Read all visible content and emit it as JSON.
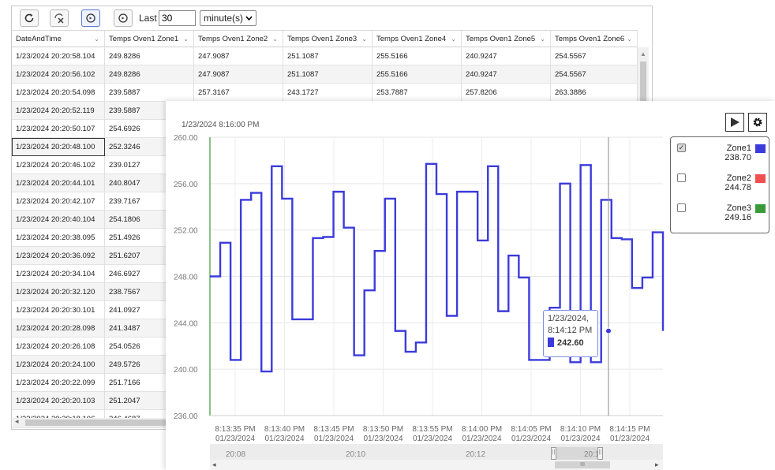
{
  "toolbar": {
    "refresh_icon": "refresh-icon",
    "clear_icon": "clear-filter-icon",
    "live_icon": "live-icon",
    "history_icon": "history-icon",
    "last_label": "Last",
    "last_value": "30",
    "unit_value": "minute(s)"
  },
  "table": {
    "columns": [
      "DateAndTime",
      "Temps Oven1 Zone1",
      "Temps Oven1 Zone2",
      "Temps Oven1 Zone3",
      "Temps Oven1 Zone4",
      "Temps Oven1 Zone5",
      "Temps Oven1 Zone6"
    ],
    "rows": [
      [
        "1/23/2024 20:20:58.104",
        "249.8286",
        "247.9087",
        "251.1087",
        "255.5166",
        "240.9247",
        "254.5567"
      ],
      [
        "1/23/2024 20:20:56.102",
        "249.8286",
        "247.9087",
        "251.1087",
        "255.5166",
        "240.9247",
        "254.5567"
      ],
      [
        "1/23/2024 20:20:54.098",
        "239.5887",
        "257.3167",
        "243.1727",
        "253.7887",
        "257.8206",
        "263.3886"
      ],
      [
        "1/23/2024 20:20:52.119",
        "239.5887",
        "",
        "",
        "",
        "",
        ""
      ],
      [
        "1/23/2024 20:20:50.107",
        "254.6926",
        "",
        "",
        "",
        "",
        ""
      ],
      [
        "1/23/2024 20:20:48.100",
        "252.3246",
        "",
        "",
        "",
        "",
        ""
      ],
      [
        "1/23/2024 20:20:46.102",
        "239.0127",
        "",
        "",
        "",
        "",
        ""
      ],
      [
        "1/23/2024 20:20:44.101",
        "240.8047",
        "",
        "",
        "",
        "",
        ""
      ],
      [
        "1/23/2024 20:20:42.107",
        "239.7167",
        "",
        "",
        "",
        "",
        ""
      ],
      [
        "1/23/2024 20:20:40.104",
        "254.1806",
        "",
        "",
        "",
        "",
        ""
      ],
      [
        "1/23/2024 20:20:38.095",
        "251.4926",
        "",
        "",
        "",
        "",
        ""
      ],
      [
        "1/23/2024 20:20:36.092",
        "251.6207",
        "",
        "",
        "",
        "",
        ""
      ],
      [
        "1/23/2024 20:20:34.104",
        "246.6927",
        "",
        "",
        "",
        "",
        ""
      ],
      [
        "1/23/2024 20:20:32.120",
        "238.7567",
        "",
        "",
        "",
        "",
        ""
      ],
      [
        "1/23/2024 20:20:30.101",
        "241.0927",
        "",
        "",
        "",
        "",
        ""
      ],
      [
        "1/23/2024 20:20:28.098",
        "241.3487",
        "",
        "",
        "",
        "",
        ""
      ],
      [
        "1/23/2024 20:20:26.108",
        "254.0526",
        "",
        "",
        "",
        "",
        ""
      ],
      [
        "1/23/2024 20:20:24.100",
        "249.5726",
        "",
        "",
        "",
        "",
        ""
      ],
      [
        "1/23/2024 20:20:22.099",
        "251.7166",
        "",
        "",
        "",
        "",
        ""
      ],
      [
        "1/23/2024 20:20:20.103",
        "251.2047",
        "",
        "",
        "",
        "",
        ""
      ],
      [
        "1/23/2024 20:20:18.106",
        "246.4687",
        "",
        "",
        "",
        "",
        ""
      ]
    ]
  },
  "chart": {
    "timestamp": "1/23/2024 8:16:00 PM",
    "play_icon": "play-icon",
    "settings_icon": "gear-icon",
    "legend": [
      {
        "name": "Zone1",
        "value": "238.70",
        "color": "#3b3bdc",
        "checked": true
      },
      {
        "name": "Zone2",
        "value": "244.78",
        "color": "#f05050",
        "checked": false
      },
      {
        "name": "Zone3",
        "value": "249.16",
        "color": "#3a9a3a",
        "checked": false
      }
    ],
    "tooltip": {
      "date": "1/23/2024,",
      "time": "8:14:12 PM",
      "value": "242.60"
    },
    "navigator_labels": [
      "20:08",
      "20:10",
      "20:12",
      "20:1"
    ]
  },
  "chart_data": {
    "type": "line",
    "step": true,
    "ylim": [
      236,
      260
    ],
    "yticks": [
      "260.00",
      "256.00",
      "252.00",
      "248.00",
      "244.00",
      "240.00",
      "236.00"
    ],
    "xticks": [
      {
        "time": "8:13:35 PM",
        "date": "01/23/2024"
      },
      {
        "time": "8:13:40 PM",
        "date": "01/23/2024"
      },
      {
        "time": "8:13:45 PM",
        "date": "01/23/2024"
      },
      {
        "time": "8:13:50 PM",
        "date": "01/23/2024"
      },
      {
        "time": "8:13:55 PM",
        "date": "01/23/2024"
      },
      {
        "time": "8:14:00 PM",
        "date": "01/23/2024"
      },
      {
        "time": "8:14:05 PM",
        "date": "01/23/2024"
      },
      {
        "time": "8:14:10 PM",
        "date": "01/23/2024"
      },
      {
        "time": "8:14:15 PM",
        "date": "01/23/2024"
      }
    ],
    "series": [
      {
        "name": "Zone1",
        "color": "#3b3bdc",
        "t": [
          0,
          2,
          4,
          6,
          8,
          10,
          12,
          14,
          16,
          18,
          20,
          22,
          24,
          26,
          28,
          30,
          32,
          34,
          36,
          38,
          40,
          42,
          44,
          46,
          48,
          50,
          52,
          54,
          56,
          58,
          60,
          62,
          64,
          66,
          68,
          70,
          72,
          74,
          76,
          78,
          80,
          82,
          84,
          86,
          88
        ],
        "values": [
          248.0,
          250.9,
          240.8,
          254.6,
          255.2,
          239.8,
          257.5,
          254.7,
          244.3,
          244.3,
          251.3,
          251.4,
          255.3,
          252.2,
          241.2,
          246.8,
          250.2,
          254.7,
          243.3,
          241.5,
          242.3,
          257.7,
          255.1,
          244.6,
          255.3,
          255.3,
          251.1,
          257.5,
          245.0,
          249.8,
          247.9,
          240.8,
          240.8,
          245.3,
          256.0,
          240.6,
          257.6,
          240.6,
          254.6,
          251.3,
          251.2,
          247.0,
          247.9,
          251.8,
          243.3
        ]
      }
    ]
  }
}
